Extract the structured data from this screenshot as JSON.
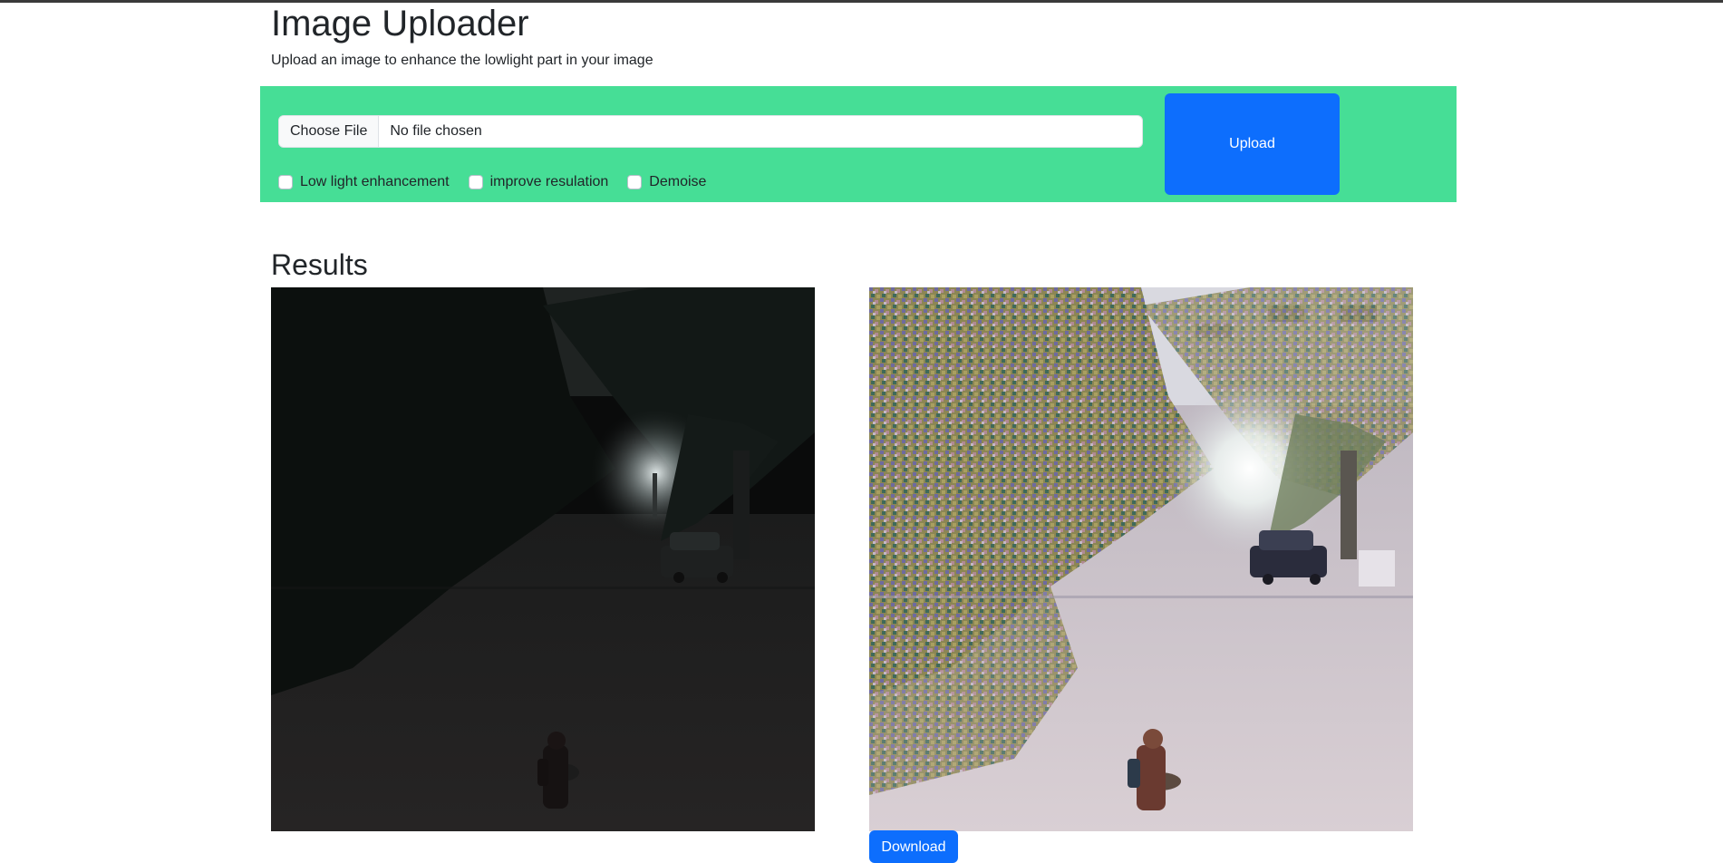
{
  "page": {
    "title": "Image Uploader",
    "subtitle": "Upload an image to enhance the lowlight part in your image"
  },
  "uploader": {
    "choose_file_label": "Choose File",
    "file_status": "No file chosen",
    "options": [
      {
        "label": "Low light enhancement",
        "checked": false
      },
      {
        "label": "improve resulation",
        "checked": false
      },
      {
        "label": "Demoise",
        "checked": false
      }
    ],
    "upload_label": "Upload",
    "panel_color": "#46de96",
    "button_color": "#0d6efd"
  },
  "results": {
    "heading": "Results",
    "images": [
      {
        "name": "original-lowlight-image",
        "icon": "night-street-photo"
      },
      {
        "name": "enhanced-image",
        "icon": "enhanced-street-photo"
      }
    ],
    "download_label": "Download"
  }
}
